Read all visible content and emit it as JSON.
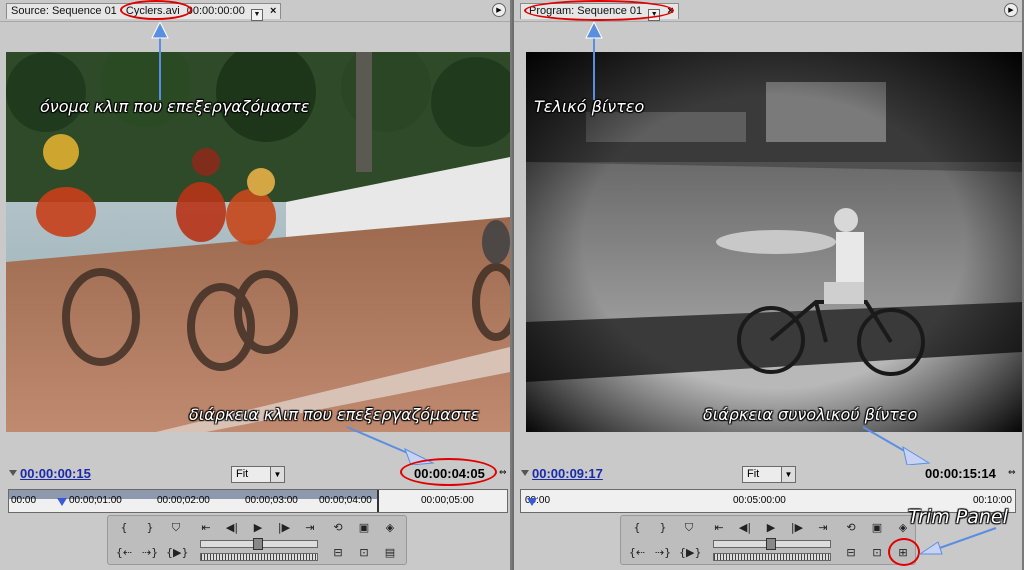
{
  "source": {
    "tab_title": "Source: Sequence 01",
    "tab_clip": "Cyclers.avi",
    "tab_time": "00:00:00:00",
    "current_time": "00:00:00:15",
    "duration": "00:00:04:05",
    "fit_label": "Fit",
    "ruler_labels": [
      "00:00",
      "00:00;01:00",
      "00:00;02:00",
      "00:00;03:00",
      "00:00;04:00",
      "00:00;05:00"
    ],
    "annotation_clip_name": "όνομα κλιπ που επεξεργαζόμαστε",
    "annotation_duration": "διάρκεια κλιπ που επεξεργαζόμαστε"
  },
  "program": {
    "tab_title": "Program: Sequence 01",
    "current_time": "00:00:09:17",
    "duration": "00:00:15:14",
    "fit_label": "Fit",
    "ruler_labels": [
      "00:00",
      "00:05:00:00",
      "00:10:00"
    ],
    "annotation_final": "Τελικό βίντεο",
    "annotation_duration": "διάρκεια συνολικού βίντεο",
    "annotation_trim": "Trim Panel"
  },
  "colors": {
    "highlight": "#e00000",
    "timecode": "#1a2aa8",
    "arrow": "#5a8fe0"
  }
}
